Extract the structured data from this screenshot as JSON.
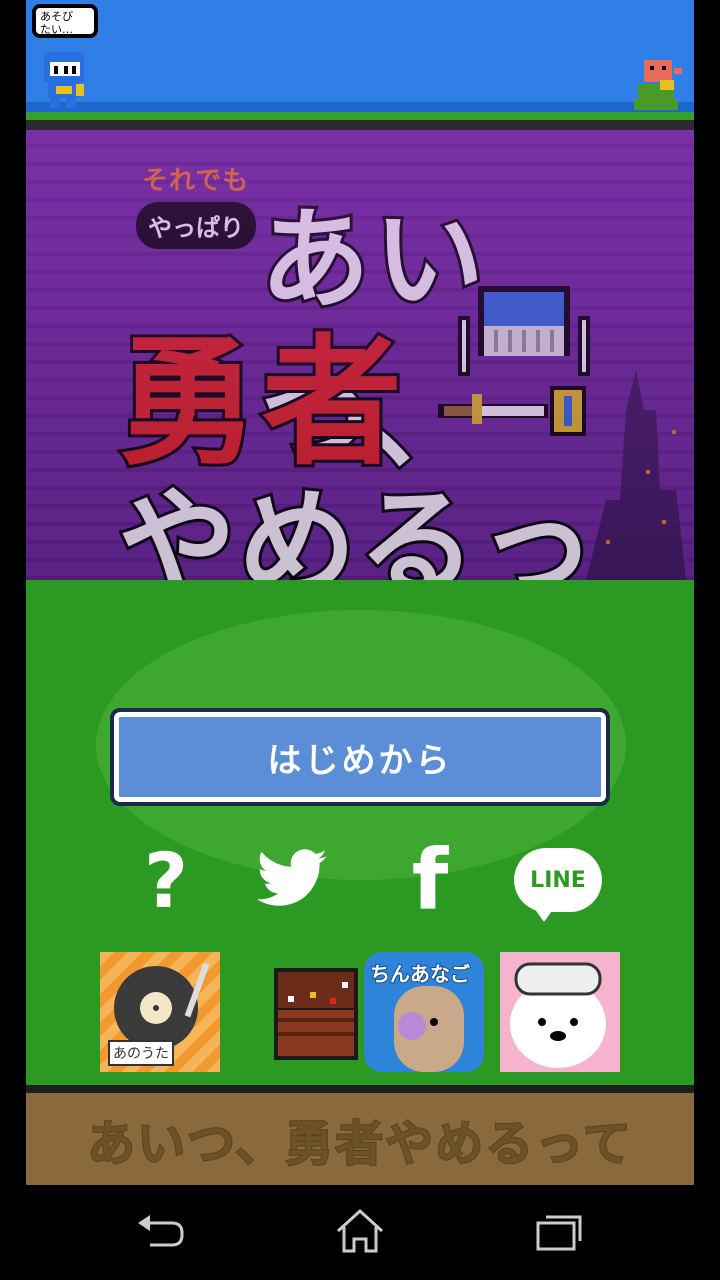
{
  "status_bubble": {
    "line1": "あそび",
    "line2": "たい…"
  },
  "title": {
    "sub_top": "それでも",
    "sub_badge": "やっぱり",
    "line1": "あいつ、",
    "line2": "勇者",
    "line3": "やめるって"
  },
  "start_button": {
    "label": "はじめから"
  },
  "social": {
    "help_glyph": "?",
    "facebook_glyph": "f",
    "line_label": "LINE"
  },
  "apps": [
    {
      "name": "record-app",
      "label": "あのうた"
    },
    {
      "name": "treasure-app",
      "label": ""
    },
    {
      "name": "chinanago-app",
      "label": "ちんあなご"
    },
    {
      "name": "polar-bear-app",
      "label": ""
    }
  ],
  "banner": {
    "text": "あいつ、勇者やめるって"
  },
  "colors": {
    "sky": "#2f7fe6",
    "title_bg": "#6b2a9a",
    "field": "#2c9a22",
    "button": "#5b8ed6",
    "banner": "#8a6a3d",
    "title_red": "#e52219"
  }
}
